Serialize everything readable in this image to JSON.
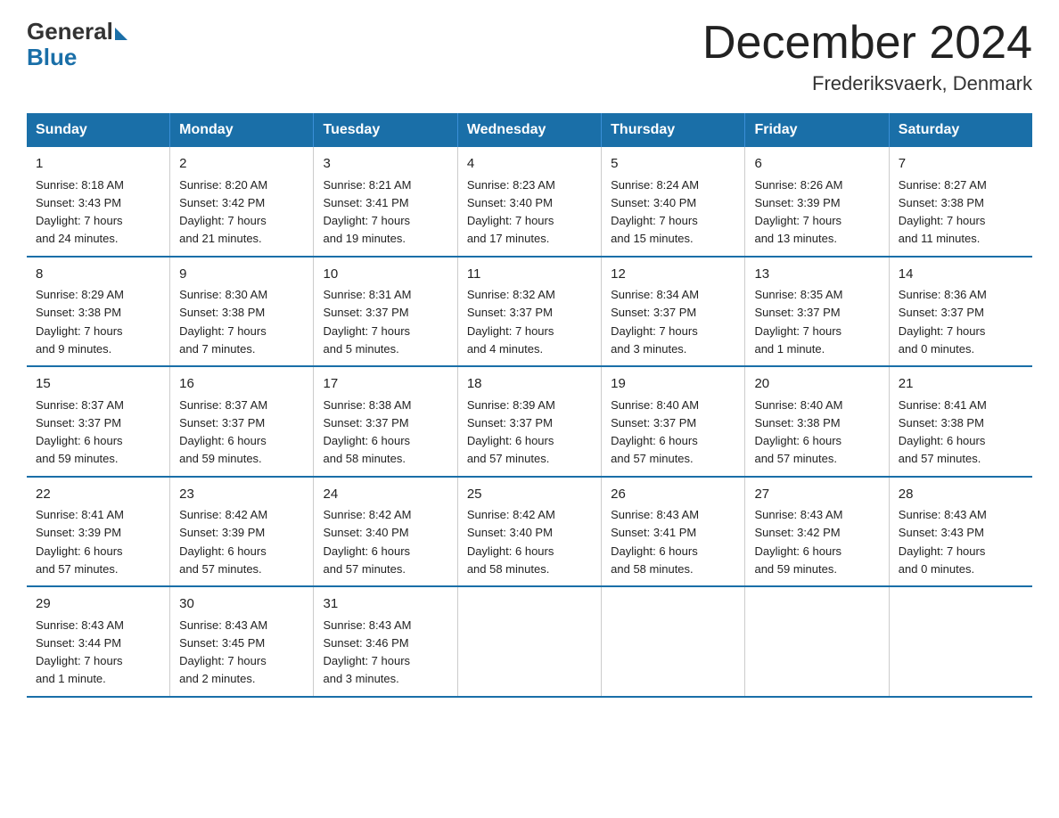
{
  "header": {
    "logo_general": "General",
    "logo_blue": "Blue",
    "month_title": "December 2024",
    "location": "Frederiksvaerk, Denmark"
  },
  "weekdays": [
    "Sunday",
    "Monday",
    "Tuesday",
    "Wednesday",
    "Thursday",
    "Friday",
    "Saturday"
  ],
  "weeks": [
    [
      {
        "day": "1",
        "sunrise": "8:18 AM",
        "sunset": "3:43 PM",
        "daylight": "7 hours and 24 minutes."
      },
      {
        "day": "2",
        "sunrise": "8:20 AM",
        "sunset": "3:42 PM",
        "daylight": "7 hours and 21 minutes."
      },
      {
        "day": "3",
        "sunrise": "8:21 AM",
        "sunset": "3:41 PM",
        "daylight": "7 hours and 19 minutes."
      },
      {
        "day": "4",
        "sunrise": "8:23 AM",
        "sunset": "3:40 PM",
        "daylight": "7 hours and 17 minutes."
      },
      {
        "day": "5",
        "sunrise": "8:24 AM",
        "sunset": "3:40 PM",
        "daylight": "7 hours and 15 minutes."
      },
      {
        "day": "6",
        "sunrise": "8:26 AM",
        "sunset": "3:39 PM",
        "daylight": "7 hours and 13 minutes."
      },
      {
        "day": "7",
        "sunrise": "8:27 AM",
        "sunset": "3:38 PM",
        "daylight": "7 hours and 11 minutes."
      }
    ],
    [
      {
        "day": "8",
        "sunrise": "8:29 AM",
        "sunset": "3:38 PM",
        "daylight": "7 hours and 9 minutes."
      },
      {
        "day": "9",
        "sunrise": "8:30 AM",
        "sunset": "3:38 PM",
        "daylight": "7 hours and 7 minutes."
      },
      {
        "day": "10",
        "sunrise": "8:31 AM",
        "sunset": "3:37 PM",
        "daylight": "7 hours and 5 minutes."
      },
      {
        "day": "11",
        "sunrise": "8:32 AM",
        "sunset": "3:37 PM",
        "daylight": "7 hours and 4 minutes."
      },
      {
        "day": "12",
        "sunrise": "8:34 AM",
        "sunset": "3:37 PM",
        "daylight": "7 hours and 3 minutes."
      },
      {
        "day": "13",
        "sunrise": "8:35 AM",
        "sunset": "3:37 PM",
        "daylight": "7 hours and 1 minute."
      },
      {
        "day": "14",
        "sunrise": "8:36 AM",
        "sunset": "3:37 PM",
        "daylight": "7 hours and 0 minutes."
      }
    ],
    [
      {
        "day": "15",
        "sunrise": "8:37 AM",
        "sunset": "3:37 PM",
        "daylight": "6 hours and 59 minutes."
      },
      {
        "day": "16",
        "sunrise": "8:37 AM",
        "sunset": "3:37 PM",
        "daylight": "6 hours and 59 minutes."
      },
      {
        "day": "17",
        "sunrise": "8:38 AM",
        "sunset": "3:37 PM",
        "daylight": "6 hours and 58 minutes."
      },
      {
        "day": "18",
        "sunrise": "8:39 AM",
        "sunset": "3:37 PM",
        "daylight": "6 hours and 57 minutes."
      },
      {
        "day": "19",
        "sunrise": "8:40 AM",
        "sunset": "3:37 PM",
        "daylight": "6 hours and 57 minutes."
      },
      {
        "day": "20",
        "sunrise": "8:40 AM",
        "sunset": "3:38 PM",
        "daylight": "6 hours and 57 minutes."
      },
      {
        "day": "21",
        "sunrise": "8:41 AM",
        "sunset": "3:38 PM",
        "daylight": "6 hours and 57 minutes."
      }
    ],
    [
      {
        "day": "22",
        "sunrise": "8:41 AM",
        "sunset": "3:39 PM",
        "daylight": "6 hours and 57 minutes."
      },
      {
        "day": "23",
        "sunrise": "8:42 AM",
        "sunset": "3:39 PM",
        "daylight": "6 hours and 57 minutes."
      },
      {
        "day": "24",
        "sunrise": "8:42 AM",
        "sunset": "3:40 PM",
        "daylight": "6 hours and 57 minutes."
      },
      {
        "day": "25",
        "sunrise": "8:42 AM",
        "sunset": "3:40 PM",
        "daylight": "6 hours and 58 minutes."
      },
      {
        "day": "26",
        "sunrise": "8:43 AM",
        "sunset": "3:41 PM",
        "daylight": "6 hours and 58 minutes."
      },
      {
        "day": "27",
        "sunrise": "8:43 AM",
        "sunset": "3:42 PM",
        "daylight": "6 hours and 59 minutes."
      },
      {
        "day": "28",
        "sunrise": "8:43 AM",
        "sunset": "3:43 PM",
        "daylight": "7 hours and 0 minutes."
      }
    ],
    [
      {
        "day": "29",
        "sunrise": "8:43 AM",
        "sunset": "3:44 PM",
        "daylight": "7 hours and 1 minute."
      },
      {
        "day": "30",
        "sunrise": "8:43 AM",
        "sunset": "3:45 PM",
        "daylight": "7 hours and 2 minutes."
      },
      {
        "day": "31",
        "sunrise": "8:43 AM",
        "sunset": "3:46 PM",
        "daylight": "7 hours and 3 minutes."
      },
      null,
      null,
      null,
      null
    ]
  ],
  "labels": {
    "sunrise": "Sunrise:",
    "sunset": "Sunset:",
    "daylight": "Daylight:"
  }
}
